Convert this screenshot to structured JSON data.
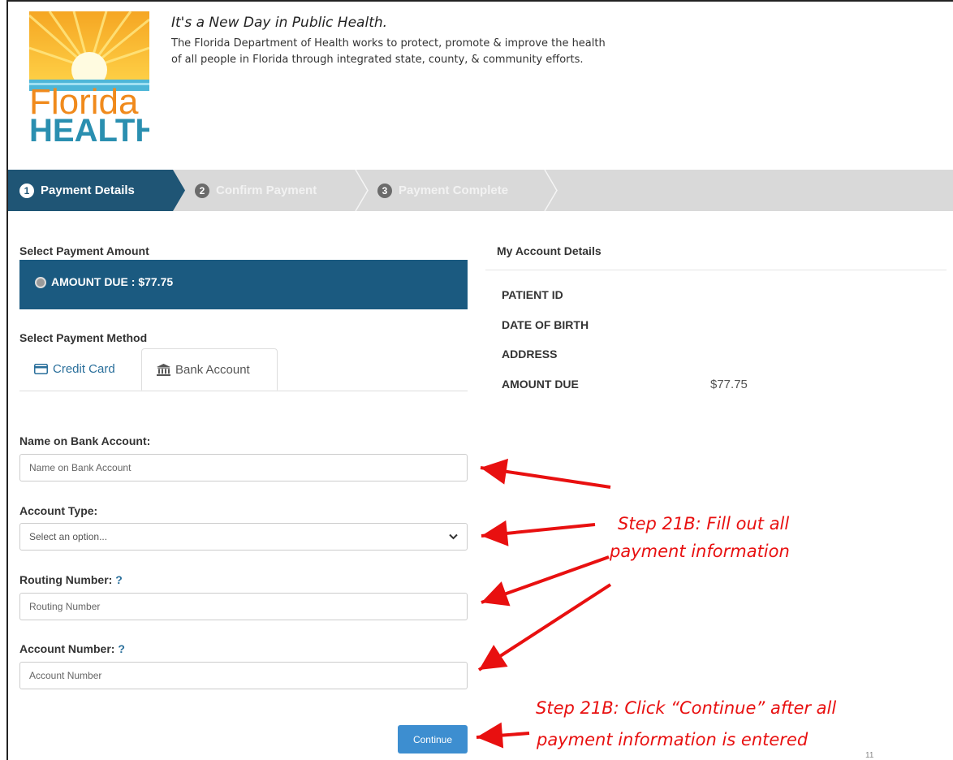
{
  "header": {
    "logo_top": "Florida",
    "logo_bottom": "HEALTH",
    "tagline_title": "It's a New Day in Public Health.",
    "tagline_text": "The Florida Department of Health works to protect, promote & improve the health of all people in Florida through integrated state, county, & community efforts."
  },
  "steps": [
    {
      "num": "1",
      "label": "Payment Details"
    },
    {
      "num": "2",
      "label": "Confirm Payment"
    },
    {
      "num": "3",
      "label": "Payment Complete"
    }
  ],
  "payment_amount": {
    "section_label": "Select Payment Amount",
    "option_label": "AMOUNT DUE : $77.75"
  },
  "payment_method": {
    "section_label": "Select Payment Method",
    "tabs": [
      {
        "label": "Credit Card"
      },
      {
        "label": "Bank Account"
      }
    ]
  },
  "form": {
    "name_label": "Name on Bank Account:",
    "name_placeholder": "Name on Bank Account",
    "name_value": "",
    "type_label": "Account Type:",
    "type_selected": "Select an option...",
    "routing_label": "Routing Number:",
    "routing_help": "?",
    "routing_placeholder": "Routing Number",
    "routing_value": "",
    "account_label": "Account Number:",
    "account_help": "?",
    "account_placeholder": "Account Number",
    "account_value": "",
    "continue_label": "Continue"
  },
  "account_details": {
    "title": "My Account Details",
    "rows": [
      {
        "key": "PATIENT ID",
        "value": ""
      },
      {
        "key": "DATE OF BIRTH",
        "value": ""
      },
      {
        "key": "ADDRESS",
        "value": ""
      },
      {
        "key": "AMOUNT DUE",
        "value": "$77.75"
      }
    ]
  },
  "annotations": {
    "note1_line1": "Step 21B: Fill out all",
    "note1_line2": "payment information",
    "note2_line1": "Step 21B: Click “Continue” after all",
    "note2_line2": "payment information is entered",
    "corner": "11"
  },
  "colors": {
    "brand_blue": "#1b5a80",
    "button_blue": "#3d8ed0",
    "annotation_red": "#e81010"
  }
}
